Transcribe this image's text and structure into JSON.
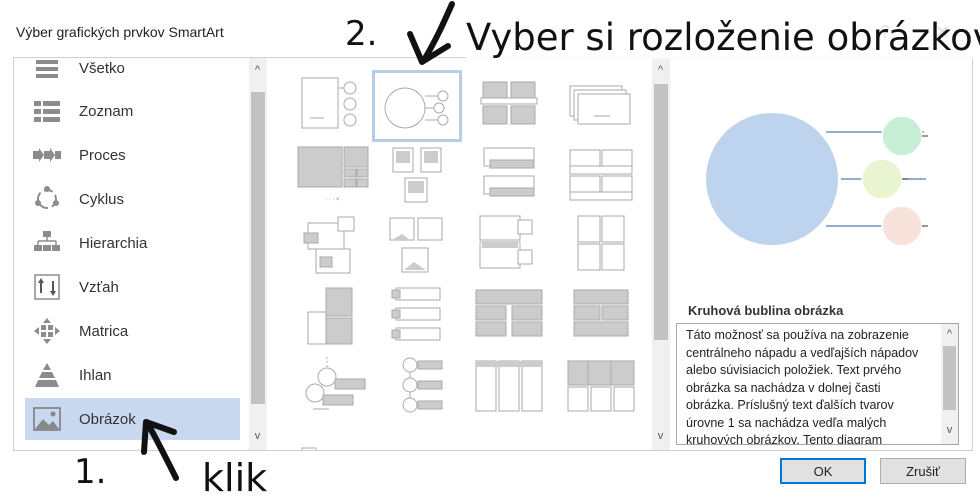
{
  "dialog": {
    "title": "Výber grafických prvkov SmartArt",
    "help_glyph": "?",
    "close_glyph": "✕"
  },
  "categories": [
    {
      "label": "Všetko",
      "icon": "all-icon"
    },
    {
      "label": "Zoznam",
      "icon": "list-icon"
    },
    {
      "label": "Proces",
      "icon": "process-icon"
    },
    {
      "label": "Cyklus",
      "icon": "cycle-icon"
    },
    {
      "label": "Hierarchia",
      "icon": "hierarchy-icon"
    },
    {
      "label": "Vzťah",
      "icon": "relationship-icon"
    },
    {
      "label": "Matrica",
      "icon": "matrix-icon"
    },
    {
      "label": "Ihlan",
      "icon": "pyramid-icon"
    },
    {
      "label": "Obrázok",
      "icon": "picture-icon",
      "selected": true
    }
  ],
  "preview": {
    "name": "Kruhová bublina obrázka",
    "description": "Táto možnosť sa používa na zobrazenie centrálneho nápadu a vedľajších nápadov alebo súvisiacich položiek. Text prvého obrázka sa nachádza v dolnej časti obrázka. Príslušný text ďalších tvarov úrovne 1 sa nachádza vedľa malých kruhových obrázkov. Tento diagram",
    "colors": {
      "main": "#bed3ee",
      "bubble1": "#c6efd6",
      "bubble2": "#e8f5d0",
      "bubble3": "#f7e2dc"
    }
  },
  "buttons": {
    "ok": "OK",
    "cancel": "Zrušiť"
  },
  "annotations": {
    "step1": "1.",
    "click": "klik",
    "step2": "2.",
    "instruction": "Vyber si rozloženie obrázkov"
  },
  "scroll": {
    "up": "^",
    "down": "v"
  }
}
